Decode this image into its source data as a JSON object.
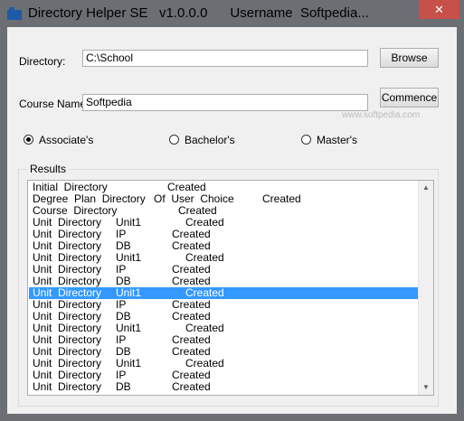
{
  "window": {
    "title": "Directory Helper SE   v1.0.0.0      Username  Softpedia...",
    "close_label": "✕"
  },
  "form": {
    "directory_label": "Directory:",
    "directory_value": "C:\\School",
    "browse_label": "Browse",
    "course_label": "Course Name:",
    "course_value": "Softpedia",
    "commence_label": "Commence",
    "watermark": "www.softpedia.com"
  },
  "degree_options": [
    {
      "label": "Associate's",
      "selected": true
    },
    {
      "label": "Bachelor's",
      "selected": false
    },
    {
      "label": "Master's",
      "selected": false
    }
  ],
  "results": {
    "title": "Results",
    "rows": [
      {
        "c1": "Initial  Directory",
        "c2": "",
        "c3": "Created",
        "c4": ""
      },
      {
        "c1": "Degree  Plan  Directory",
        "c2": "Of  User  Choice",
        "c3": "",
        "c4": "Created"
      },
      {
        "c1": "Course  Directory",
        "c2": "",
        "c3": "Created",
        "c4": ""
      },
      {
        "c1": "Unit  Directory",
        "c2": "Unit1",
        "c3": "Created",
        "c4": ""
      },
      {
        "c1": "Unit  Directory",
        "c2": "IP",
        "c3": "Created",
        "c4": ""
      },
      {
        "c1": "Unit  Directory",
        "c2": "DB",
        "c3": "Created",
        "c4": ""
      },
      {
        "c1": "Unit  Directory",
        "c2": "Unit1",
        "c3": "Created",
        "c4": ""
      },
      {
        "c1": "Unit  Directory",
        "c2": "IP",
        "c3": "Created",
        "c4": ""
      },
      {
        "c1": "Unit  Directory",
        "c2": "DB",
        "c3": "Created",
        "c4": ""
      },
      {
        "c1": "Unit  Directory",
        "c2": "Unit1",
        "c3": "Created",
        "c4": "",
        "selected": true
      },
      {
        "c1": "Unit  Directory",
        "c2": "IP",
        "c3": "Created",
        "c4": ""
      },
      {
        "c1": "Unit  Directory",
        "c2": "DB",
        "c3": "Created",
        "c4": ""
      },
      {
        "c1": "Unit  Directory",
        "c2": "Unit1",
        "c3": "Created",
        "c4": ""
      },
      {
        "c1": "Unit  Directory",
        "c2": "IP",
        "c3": "Created",
        "c4": ""
      },
      {
        "c1": "Unit  Directory",
        "c2": "DB",
        "c3": "Created",
        "c4": ""
      },
      {
        "c1": "Unit  Directory",
        "c2": "Unit1",
        "c3": "Created",
        "c4": ""
      },
      {
        "c1": "Unit  Directory",
        "c2": "IP",
        "c3": "Created",
        "c4": ""
      },
      {
        "c1": "Unit  Directory",
        "c2": "DB",
        "c3": "Created",
        "c4": ""
      }
    ]
  },
  "colors": {
    "selection": "#3399ff",
    "close_button": "#c7504b",
    "frame": "#6b6e73"
  }
}
